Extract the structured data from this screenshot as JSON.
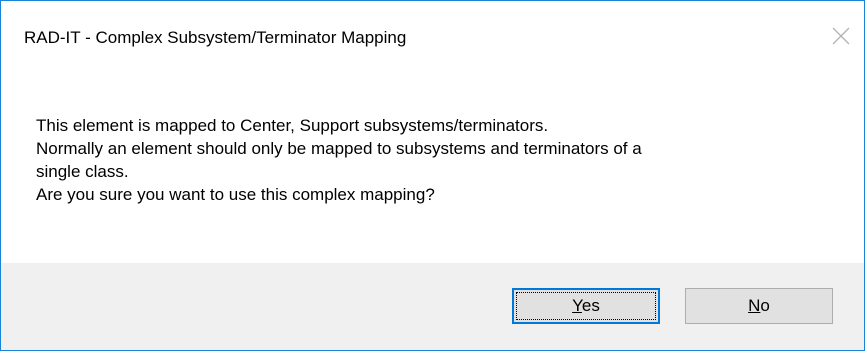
{
  "window": {
    "title": "RAD-IT - Complex Subsystem/Terminator Mapping",
    "close_icon": "close-icon",
    "accent_color": "#1883d7"
  },
  "message": {
    "lines": [
      "This element is mapped to Center, Support subsystems/terminators.",
      "Normally an element should only be mapped to subsystems and terminators of a",
      "single class.",
      "Are you sure you want to use this complex mapping?"
    ]
  },
  "buttons": {
    "yes": {
      "accel": "Y",
      "rest": "es",
      "is_default": true
    },
    "no": {
      "accel": "N",
      "rest": "o",
      "is_default": false
    }
  },
  "colors": {
    "footer_background": "#f0f0f0",
    "button_face": "#e1e1e1",
    "default_button_border": "#0078d7"
  }
}
